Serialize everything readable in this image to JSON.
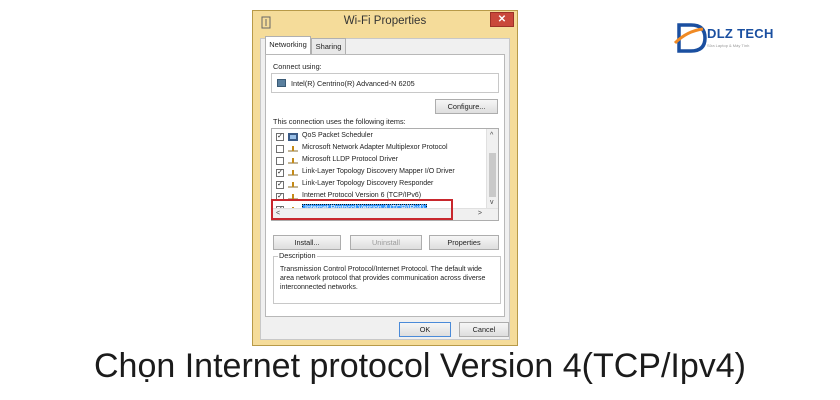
{
  "window": {
    "title": "Wi-Fi Properties",
    "close_label": "✕",
    "tabs": [
      {
        "label": "Networking",
        "active": true
      },
      {
        "label": "Sharing",
        "active": false
      }
    ],
    "connect_using_label": "Connect using:",
    "adapter_name": "Intel(R) Centrino(R) Advanced-N 6205",
    "configure_label": "Configure...",
    "items_label": "This connection uses the following items:",
    "items": [
      {
        "label": "QoS Packet Scheduler",
        "checked": true,
        "icon": "scheduler-icon"
      },
      {
        "label": "Microsoft Network Adapter Multiplexor Protocol",
        "checked": false,
        "icon": "protocol-icon"
      },
      {
        "label": "Microsoft LLDP Protocol Driver",
        "checked": false,
        "icon": "protocol-icon"
      },
      {
        "label": "Link-Layer Topology Discovery Mapper I/O Driver",
        "checked": true,
        "icon": "protocol-icon"
      },
      {
        "label": "Link-Layer Topology Discovery Responder",
        "checked": true,
        "icon": "protocol-icon"
      },
      {
        "label": "Internet Protocol Version 6 (TCP/IPv6)",
        "checked": true,
        "icon": "protocol-icon"
      },
      {
        "label": "Internet Protocol Version 4 (TCP/IPv4)",
        "checked": true,
        "icon": "protocol-icon",
        "selected": true
      }
    ],
    "install_label": "Install...",
    "uninstall_label": "Uninstall",
    "properties_label": "Properties",
    "description_title": "Description",
    "description_text": "Transmission Control Protocol/Internet Protocol. The default wide area network protocol that provides communication across diverse interconnected networks.",
    "ok_label": "OK",
    "cancel_label": "Cancel"
  },
  "caption": "Chọn Internet protocol Version 4(TCP/Ipv4)",
  "logo": {
    "text": "DLZ TECH",
    "subtext": "Sửa Laptop & Máy Tính"
  },
  "colors": {
    "window_frame": "#f5dc9a",
    "highlight_box": "#c8272d",
    "selection": "#3399ff",
    "logo_orange": "#f08a24",
    "logo_blue": "#1a4fa0"
  }
}
